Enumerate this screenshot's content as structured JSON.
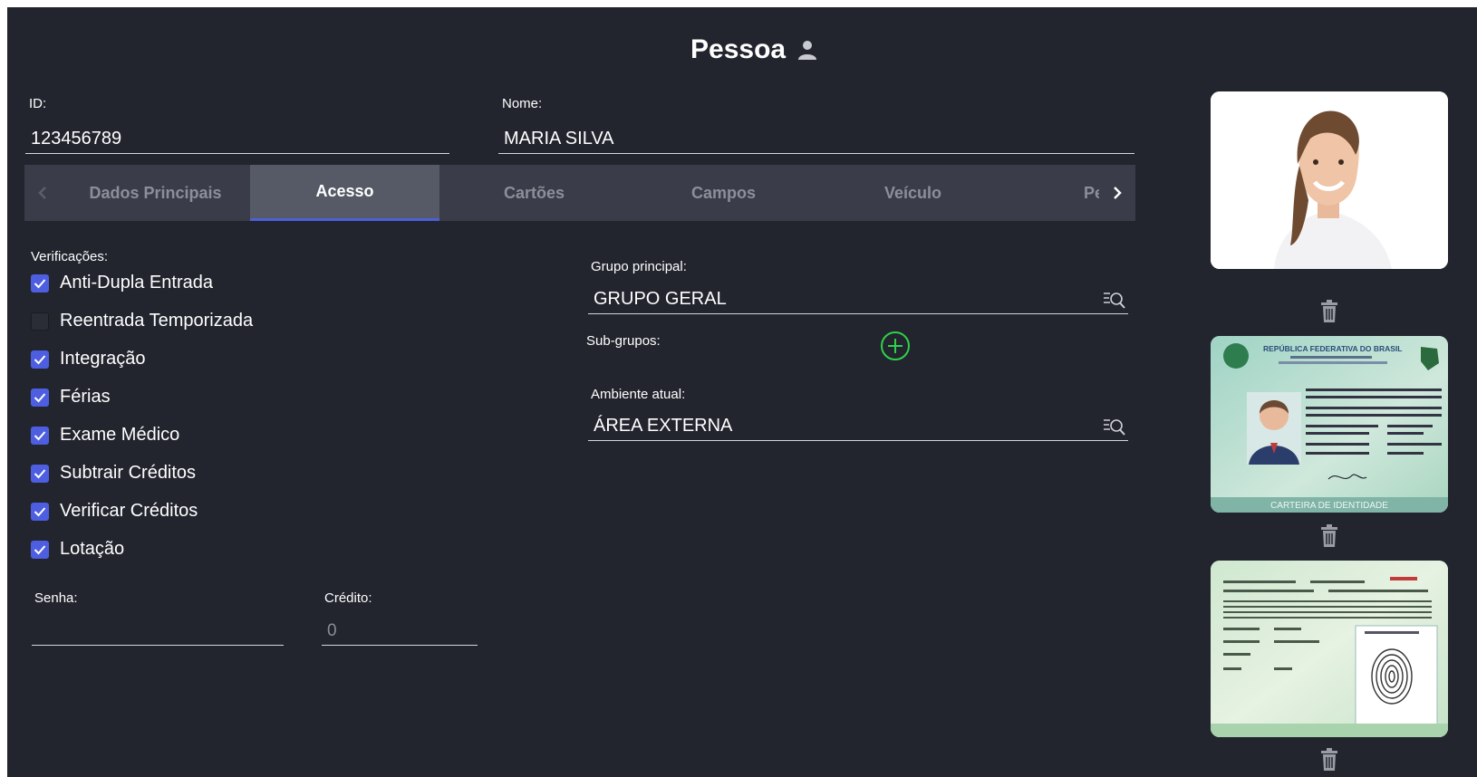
{
  "header": {
    "title": "Pessoa",
    "icon": "person-icon"
  },
  "fields": {
    "id": {
      "label": "ID:",
      "value": "123456789"
    },
    "nome": {
      "label": "Nome:",
      "value": "MARIA SILVA"
    }
  },
  "tabs": {
    "prev_icon": "chevron-left-icon",
    "next_icon": "chevron-right-icon",
    "items": [
      {
        "label": "Dados Principais",
        "active": false
      },
      {
        "label": "Acesso",
        "active": true
      },
      {
        "label": "Cartões",
        "active": false
      },
      {
        "label": "Campos",
        "active": false
      },
      {
        "label": "Veículo",
        "active": false
      },
      {
        "label": "Pe",
        "active": false
      }
    ]
  },
  "verificacoes": {
    "label": "Verificações:",
    "items": [
      {
        "label": "Anti-Dupla Entrada",
        "checked": true
      },
      {
        "label": "Reentrada Temporizada",
        "checked": false
      },
      {
        "label": "Integração",
        "checked": true
      },
      {
        "label": "Férias",
        "checked": true
      },
      {
        "label": "Exame Médico",
        "checked": true
      },
      {
        "label": "Subtrair Créditos",
        "checked": true
      },
      {
        "label": "Verificar Créditos",
        "checked": true
      },
      {
        "label": "Lotação",
        "checked": true
      }
    ]
  },
  "senha": {
    "label": "Senha:",
    "value": ""
  },
  "credito": {
    "label": "Crédito:",
    "placeholder": "0"
  },
  "grupo_principal": {
    "label": "Grupo principal:",
    "value": "GRUPO GERAL"
  },
  "sub_grupos": {
    "label": "Sub-grupos:"
  },
  "ambiente": {
    "label": "Ambiente atual:",
    "value": "ÁREA EXTERNA"
  },
  "documents": {
    "id_card_title": "REPÚBLICA FEDERATIVA DO BRASIL",
    "id_card_footer": "CARTEIRA DE IDENTIDADE"
  },
  "colors": {
    "accent": "#4d5ee0",
    "background": "#22242e",
    "add": "#2fd14a"
  }
}
